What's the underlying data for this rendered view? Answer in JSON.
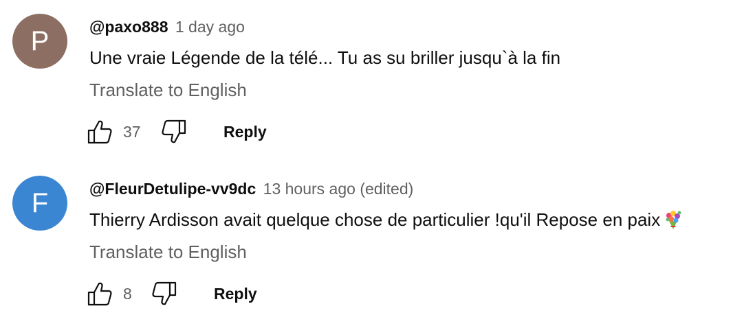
{
  "comments": [
    {
      "avatar_letter": "P",
      "avatar_color": "#8d6e63",
      "author": "@paxo888",
      "time": "1 day ago",
      "text": "Une vraie Légende de la télé... Tu as su briller jusqu`à la fin",
      "translate_label": "Translate to English",
      "likes": "37",
      "reply_label": "Reply"
    },
    {
      "avatar_letter": "F",
      "avatar_color": "#3b86d2",
      "author": "@FleurDetulipe-vv9dc",
      "time": "13 hours ago (edited)",
      "text": "Thierry Ardisson avait quelque chose de particulier !qu'il Repose en paix",
      "emoji": "bouquet-emoji",
      "translate_label": "Translate to English",
      "likes": "8",
      "reply_label": "Reply"
    }
  ],
  "icons": {
    "like": "thumb-up-icon",
    "dislike": "thumb-down-icon"
  },
  "colors": {
    "secondary_text": "#606060",
    "primary_text": "#0f0f0f"
  }
}
